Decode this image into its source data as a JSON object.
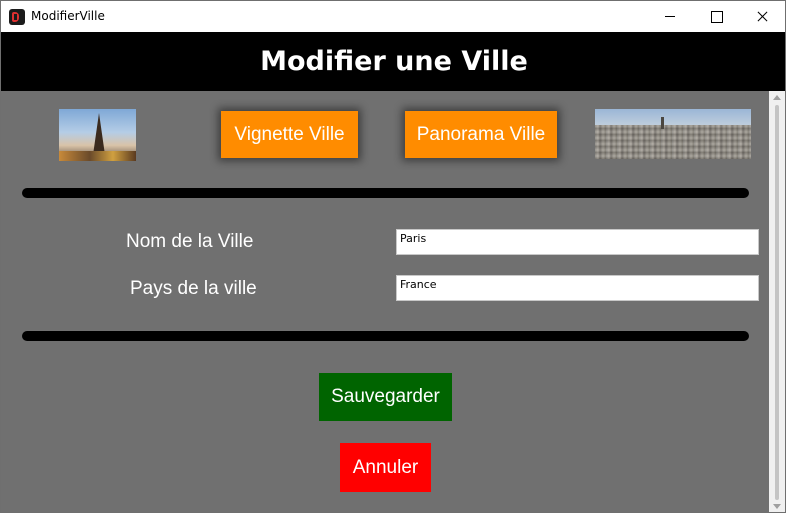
{
  "window": {
    "title": "ModifierVille",
    "controls": {
      "minimize": "minimize-icon",
      "maximize": "maximize-icon",
      "close": "close-icon"
    }
  },
  "header": {
    "title": "Modifier une Ville"
  },
  "media": {
    "vignette_button": "Vignette Ville",
    "panorama_button": "Panorama Ville",
    "vignette_image": "eiffel-tower-thumbnail",
    "panorama_image": "paris-panorama"
  },
  "form": {
    "city_name_label": "Nom de la Ville",
    "city_name_value": "Paris",
    "country_label": "Pays de la ville",
    "country_value": "France"
  },
  "actions": {
    "save_label": "Sauvegarder",
    "cancel_label": "Annuler"
  },
  "colors": {
    "header_bg": "#000000",
    "content_bg": "#707070",
    "accent_orange": "#ff8c00",
    "save_green": "#006400",
    "cancel_red": "#ff0000"
  }
}
